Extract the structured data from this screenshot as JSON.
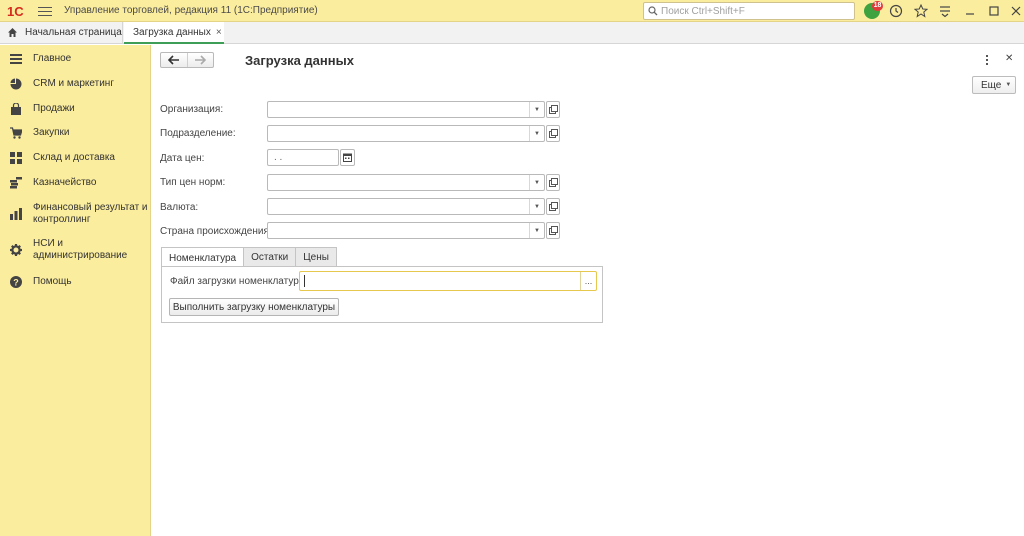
{
  "titlebar": {
    "logo_text": "1С",
    "app_title": "Управление торговлей, редакция 11  (1С:Предприятие)",
    "search_placeholder": "Поиск Ctrl+Shift+F",
    "notifications_count": "18"
  },
  "tabs": {
    "home_label": "Начальная страница",
    "active_label": "Загрузка данных",
    "close_glyph": "×"
  },
  "sidebar": {
    "items": [
      {
        "label": "Главное",
        "icon": "menu-lines-icon"
      },
      {
        "label": "CRM и маркетинг",
        "icon": "pie-chart-icon"
      },
      {
        "label": "Продажи",
        "icon": "shopping-bag-icon"
      },
      {
        "label": "Закупки",
        "icon": "cart-icon"
      },
      {
        "label": "Склад и доставка",
        "icon": "grid-boxes-icon"
      },
      {
        "label": "Казначейство",
        "icon": "coins-icon"
      },
      {
        "label": "Финансовый результат и контроллинг",
        "icon": "bar-chart-icon"
      },
      {
        "label": "НСИ и администрирование",
        "icon": "gear-icon"
      },
      {
        "label": "Помощь",
        "icon": "help-icon"
      }
    ]
  },
  "form": {
    "title": "Загрузка данных",
    "more_button": "Еще",
    "fields": {
      "organization": {
        "label": "Организация:",
        "value": ""
      },
      "department": {
        "label": "Подразделение:",
        "value": ""
      },
      "price_date": {
        "label": "Дата цен:",
        "value": ". ."
      },
      "norm_price_type": {
        "label": "Тип цен норм:",
        "value": ""
      },
      "currency": {
        "label": "Валюта:",
        "value": ""
      },
      "origin_country": {
        "label": "Страна происхождения:",
        "value": ""
      }
    },
    "page_tabs": [
      "Номенклатура",
      "Остатки",
      "Цены"
    ],
    "active_page_tab": "Номенклатура",
    "nomenclature": {
      "file_label": "Файл загрузки номенклатуры:",
      "file_value": "",
      "select_glyph": "...",
      "run_button": "Выполнить загрузку номенклатуры"
    }
  },
  "colors": {
    "panel_yellow": "#fbed9e",
    "active_tab_underline": "#3e9e58",
    "focus_border": "#e6c84e",
    "logo_red": "#d52b1e"
  }
}
